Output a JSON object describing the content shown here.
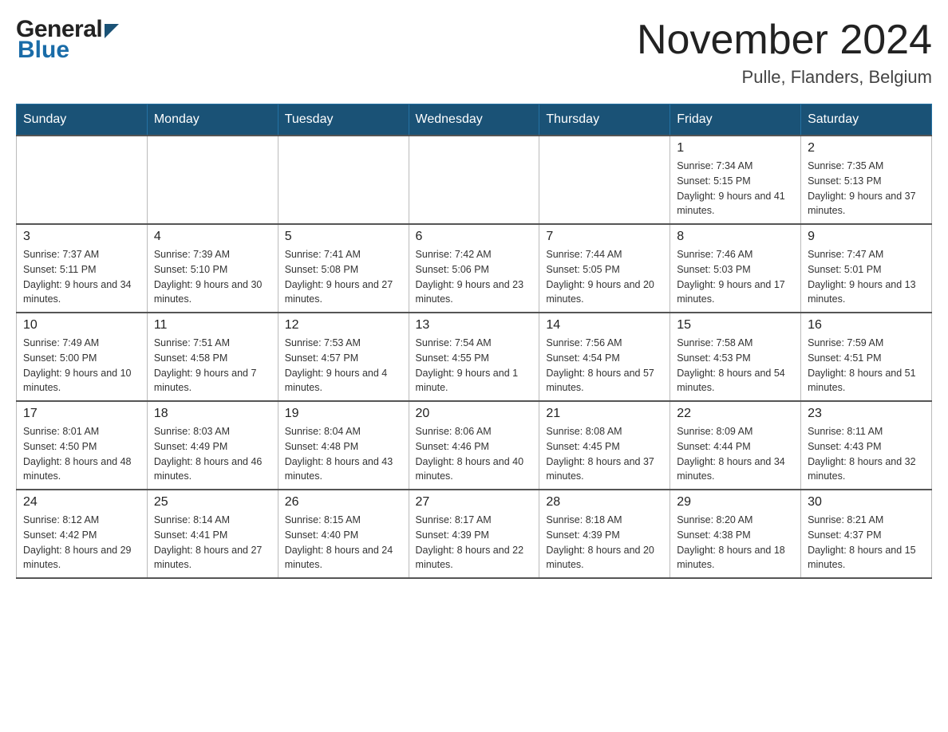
{
  "header": {
    "month_title": "November 2024",
    "location": "Pulle, Flanders, Belgium",
    "logo_general": "General",
    "logo_blue": "Blue"
  },
  "days_of_week": [
    "Sunday",
    "Monday",
    "Tuesday",
    "Wednesday",
    "Thursday",
    "Friday",
    "Saturday"
  ],
  "weeks": [
    {
      "days": [
        {
          "number": "",
          "info": "",
          "empty": true
        },
        {
          "number": "",
          "info": "",
          "empty": true
        },
        {
          "number": "",
          "info": "",
          "empty": true
        },
        {
          "number": "",
          "info": "",
          "empty": true
        },
        {
          "number": "",
          "info": "",
          "empty": true
        },
        {
          "number": "1",
          "info": "Sunrise: 7:34 AM\nSunset: 5:15 PM\nDaylight: 9 hours and 41 minutes."
        },
        {
          "number": "2",
          "info": "Sunrise: 7:35 AM\nSunset: 5:13 PM\nDaylight: 9 hours and 37 minutes."
        }
      ]
    },
    {
      "days": [
        {
          "number": "3",
          "info": "Sunrise: 7:37 AM\nSunset: 5:11 PM\nDaylight: 9 hours and 34 minutes."
        },
        {
          "number": "4",
          "info": "Sunrise: 7:39 AM\nSunset: 5:10 PM\nDaylight: 9 hours and 30 minutes."
        },
        {
          "number": "5",
          "info": "Sunrise: 7:41 AM\nSunset: 5:08 PM\nDaylight: 9 hours and 27 minutes."
        },
        {
          "number": "6",
          "info": "Sunrise: 7:42 AM\nSunset: 5:06 PM\nDaylight: 9 hours and 23 minutes."
        },
        {
          "number": "7",
          "info": "Sunrise: 7:44 AM\nSunset: 5:05 PM\nDaylight: 9 hours and 20 minutes."
        },
        {
          "number": "8",
          "info": "Sunrise: 7:46 AM\nSunset: 5:03 PM\nDaylight: 9 hours and 17 minutes."
        },
        {
          "number": "9",
          "info": "Sunrise: 7:47 AM\nSunset: 5:01 PM\nDaylight: 9 hours and 13 minutes."
        }
      ]
    },
    {
      "days": [
        {
          "number": "10",
          "info": "Sunrise: 7:49 AM\nSunset: 5:00 PM\nDaylight: 9 hours and 10 minutes."
        },
        {
          "number": "11",
          "info": "Sunrise: 7:51 AM\nSunset: 4:58 PM\nDaylight: 9 hours and 7 minutes."
        },
        {
          "number": "12",
          "info": "Sunrise: 7:53 AM\nSunset: 4:57 PM\nDaylight: 9 hours and 4 minutes."
        },
        {
          "number": "13",
          "info": "Sunrise: 7:54 AM\nSunset: 4:55 PM\nDaylight: 9 hours and 1 minute."
        },
        {
          "number": "14",
          "info": "Sunrise: 7:56 AM\nSunset: 4:54 PM\nDaylight: 8 hours and 57 minutes."
        },
        {
          "number": "15",
          "info": "Sunrise: 7:58 AM\nSunset: 4:53 PM\nDaylight: 8 hours and 54 minutes."
        },
        {
          "number": "16",
          "info": "Sunrise: 7:59 AM\nSunset: 4:51 PM\nDaylight: 8 hours and 51 minutes."
        }
      ]
    },
    {
      "days": [
        {
          "number": "17",
          "info": "Sunrise: 8:01 AM\nSunset: 4:50 PM\nDaylight: 8 hours and 48 minutes."
        },
        {
          "number": "18",
          "info": "Sunrise: 8:03 AM\nSunset: 4:49 PM\nDaylight: 8 hours and 46 minutes."
        },
        {
          "number": "19",
          "info": "Sunrise: 8:04 AM\nSunset: 4:48 PM\nDaylight: 8 hours and 43 minutes."
        },
        {
          "number": "20",
          "info": "Sunrise: 8:06 AM\nSunset: 4:46 PM\nDaylight: 8 hours and 40 minutes."
        },
        {
          "number": "21",
          "info": "Sunrise: 8:08 AM\nSunset: 4:45 PM\nDaylight: 8 hours and 37 minutes."
        },
        {
          "number": "22",
          "info": "Sunrise: 8:09 AM\nSunset: 4:44 PM\nDaylight: 8 hours and 34 minutes."
        },
        {
          "number": "23",
          "info": "Sunrise: 8:11 AM\nSunset: 4:43 PM\nDaylight: 8 hours and 32 minutes."
        }
      ]
    },
    {
      "days": [
        {
          "number": "24",
          "info": "Sunrise: 8:12 AM\nSunset: 4:42 PM\nDaylight: 8 hours and 29 minutes."
        },
        {
          "number": "25",
          "info": "Sunrise: 8:14 AM\nSunset: 4:41 PM\nDaylight: 8 hours and 27 minutes."
        },
        {
          "number": "26",
          "info": "Sunrise: 8:15 AM\nSunset: 4:40 PM\nDaylight: 8 hours and 24 minutes."
        },
        {
          "number": "27",
          "info": "Sunrise: 8:17 AM\nSunset: 4:39 PM\nDaylight: 8 hours and 22 minutes."
        },
        {
          "number": "28",
          "info": "Sunrise: 8:18 AM\nSunset: 4:39 PM\nDaylight: 8 hours and 20 minutes."
        },
        {
          "number": "29",
          "info": "Sunrise: 8:20 AM\nSunset: 4:38 PM\nDaylight: 8 hours and 18 minutes."
        },
        {
          "number": "30",
          "info": "Sunrise: 8:21 AM\nSunset: 4:37 PM\nDaylight: 8 hours and 15 minutes."
        }
      ]
    }
  ]
}
